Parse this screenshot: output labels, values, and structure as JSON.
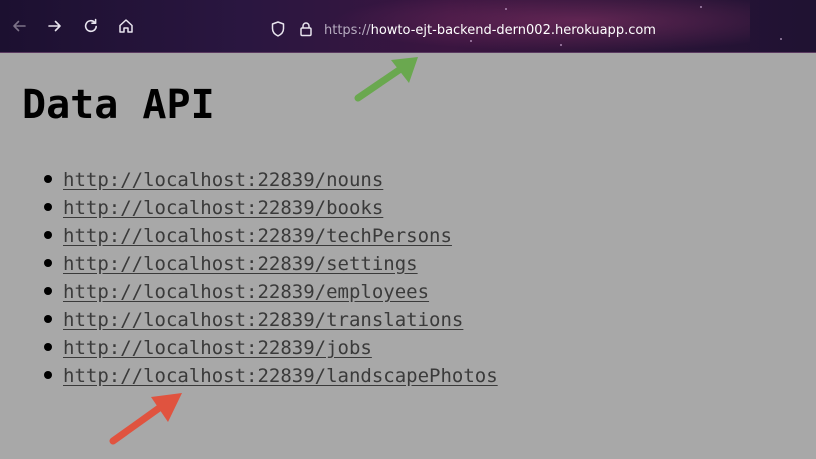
{
  "browser": {
    "url_scheme": "https://",
    "url_host": "howto-ejt-backend-dern002.herokuapp.com",
    "icons": [
      "back-arrow-icon",
      "forward-arrow-icon",
      "reload-icon",
      "home-icon",
      "shield-icon",
      "lock-icon"
    ]
  },
  "page": {
    "title": "Data API",
    "links": [
      {
        "label": "http://localhost:22839/nouns"
      },
      {
        "label": "http://localhost:22839/books"
      },
      {
        "label": "http://localhost:22839/techPersons"
      },
      {
        "label": "http://localhost:22839/settings"
      },
      {
        "label": "http://localhost:22839/employees"
      },
      {
        "label": "http://localhost:22839/translations"
      },
      {
        "label": "http://localhost:22839/jobs"
      },
      {
        "label": "http://localhost:22839/landscapePhotos"
      }
    ]
  },
  "annotations": {
    "green_arrow_color": "#6aa84f",
    "red_arrow_color": "#e0533f"
  }
}
